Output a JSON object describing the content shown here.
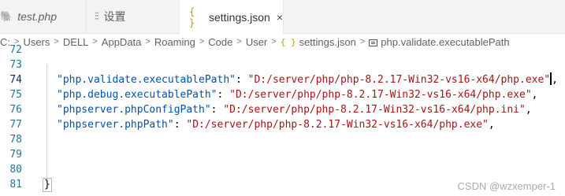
{
  "tabs": [
    {
      "label": "test.php",
      "icon": "php-elephant-icon"
    },
    {
      "label": "设置",
      "icon": "settings-sliders-icon"
    },
    {
      "label": "settings.json",
      "icon": "json-braces-icon",
      "active": true,
      "close": "×"
    }
  ],
  "breadcrumb": {
    "items": [
      "C:",
      "Users",
      "DELL",
      "AppData",
      "Roaming",
      "Code",
      "User",
      "settings.json",
      "php.validate.executablePath"
    ],
    "separator": ">"
  },
  "editor": {
    "line_numbers": [
      "72",
      "73",
      "74",
      "75",
      "76",
      "77",
      "78",
      "79",
      "80",
      "81"
    ],
    "current_line": "74",
    "lines": [
      {
        "key": "\"php.validate.executablePath\"",
        "colon": ": ",
        "value": "\"D:/server/php/php-8.2.17-Win32-vs16-x64/php.exe\"",
        "comma": ","
      },
      {
        "key": "\"php.debug.executablePath\"",
        "colon": ": ",
        "value": "\"D:/server/php/php-8.2.17-Win32-vs16-x64/php.exe\"",
        "comma": ","
      },
      {
        "key": "\"phpserver.phpConfigPath\"",
        "colon": ": ",
        "value": "\"D:/server/php/php-8.2.17-Win32-vs16-x64/php.ini\"",
        "comma": ","
      },
      {
        "key": "\"phpserver.phpPath\"",
        "colon": ": ",
        "value": "\"D:/server/php/php-8.2.17-Win32-vs16-x64/php.exe\"",
        "comma": ","
      }
    ],
    "closing_brace": "}"
  },
  "watermark": "CSDN @wzxemper-1",
  "colors": {
    "key": "#0451a5",
    "string": "#a31515",
    "line_number": "#237893",
    "json_icon": "#b5a300"
  }
}
